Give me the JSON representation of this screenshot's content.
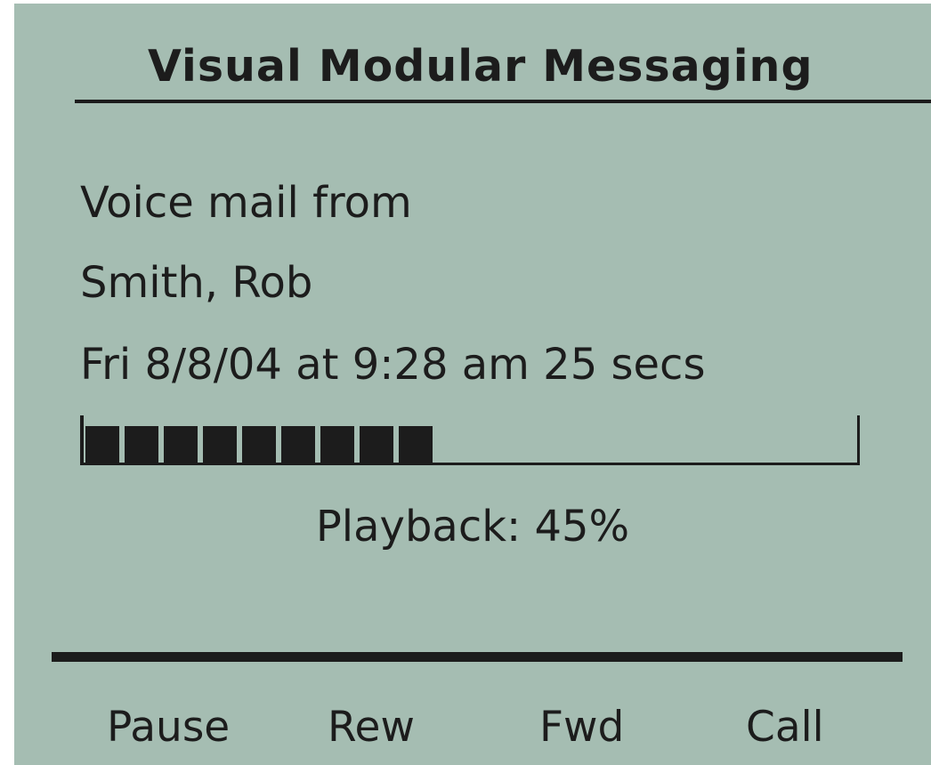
{
  "screen": {
    "title": "Visual Modular Messaging"
  },
  "message": {
    "heading": "Voice mail from",
    "sender": "Smith, Rob",
    "details": "Fri 8/8/04 at 9:28 am 25 secs"
  },
  "playback": {
    "percent": 45,
    "label": "Playback: 45%"
  },
  "softkeys": [
    {
      "label": "Pause"
    },
    {
      "label": "Rew"
    },
    {
      "label": "Fwd"
    },
    {
      "label": "Call"
    }
  ],
  "colors": {
    "lcd_background": "#a5bdb2",
    "lcd_foreground": "#1c1c1c"
  }
}
